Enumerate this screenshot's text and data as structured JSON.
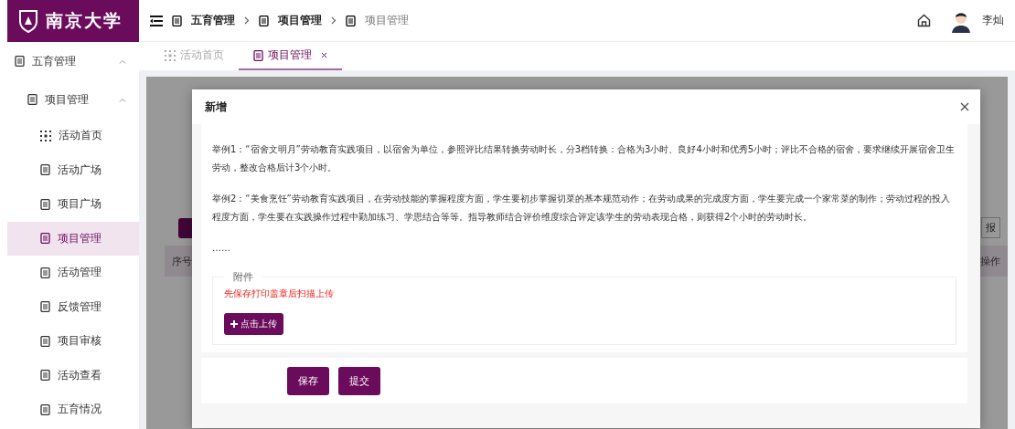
{
  "logo": {
    "text": "南京大学"
  },
  "breadcrumb": [
    {
      "label": "五育管理",
      "current": false
    },
    {
      "label": "项目管理",
      "current": false
    },
    {
      "label": "项目管理",
      "current": true
    }
  ],
  "user": {
    "name": "李灿"
  },
  "tabs": [
    {
      "label": "活动首页",
      "kind": "grid",
      "selected": false,
      "closable": false
    },
    {
      "label": "项目管理",
      "kind": "doc",
      "selected": true,
      "closable": true
    }
  ],
  "sidebar": {
    "items": [
      {
        "label": "五育管理",
        "expanded": true,
        "children": [
          {
            "label": "项目管理",
            "expanded": true,
            "children": [
              {
                "label": "活动首页",
                "kind": "grid",
                "selected": false
              },
              {
                "label": "活动广场",
                "kind": "doc",
                "selected": false
              },
              {
                "label": "项目广场",
                "kind": "doc",
                "selected": false
              },
              {
                "label": "项目管理",
                "kind": "doc",
                "selected": true
              },
              {
                "label": "活动管理",
                "kind": "doc",
                "selected": false
              },
              {
                "label": "反馈管理",
                "kind": "doc",
                "selected": false
              },
              {
                "label": "项目审核",
                "kind": "doc",
                "selected": false
              },
              {
                "label": "活动查看",
                "kind": "doc",
                "selected": false
              },
              {
                "label": "五育情况",
                "kind": "doc",
                "selected": false
              }
            ]
          }
        ]
      }
    ]
  },
  "background_page": {
    "button_label": "报",
    "columns": [
      "序号",
      "操作"
    ]
  },
  "dialog": {
    "title": "新增",
    "paragraphs": [
      "举例1：“宿舍文明月”劳动教育实践项目，以宿舍为单位，参照评比结果转换劳动时长，分3档转换：合格为3小时、良好4小时和优秀5小时；评比不合格的宿舍，要求继续开展宿舍卫生劳动，整改合格后计3个小时。",
      "举例2：“美食烹饪”劳动教育实践项目，在劳动技能的掌握程度方面，学生要初步掌握切菜的基本规范动作；在劳动成果的完成度方面，学生要完成一个家常菜的制作；劳动过程的投入程度方面，学生要在实践操作过程中勤加练习、学思结合等等。指导教师结合评价维度综合评定该学生的劳动表现合格，则获得2个小时的劳动时长。",
      "……"
    ],
    "attachment": {
      "legend": "附件",
      "notice": "先保存打印盖章后扫描上传",
      "upload_button": "点击上传"
    },
    "buttons": [
      "保存",
      "提交"
    ]
  }
}
